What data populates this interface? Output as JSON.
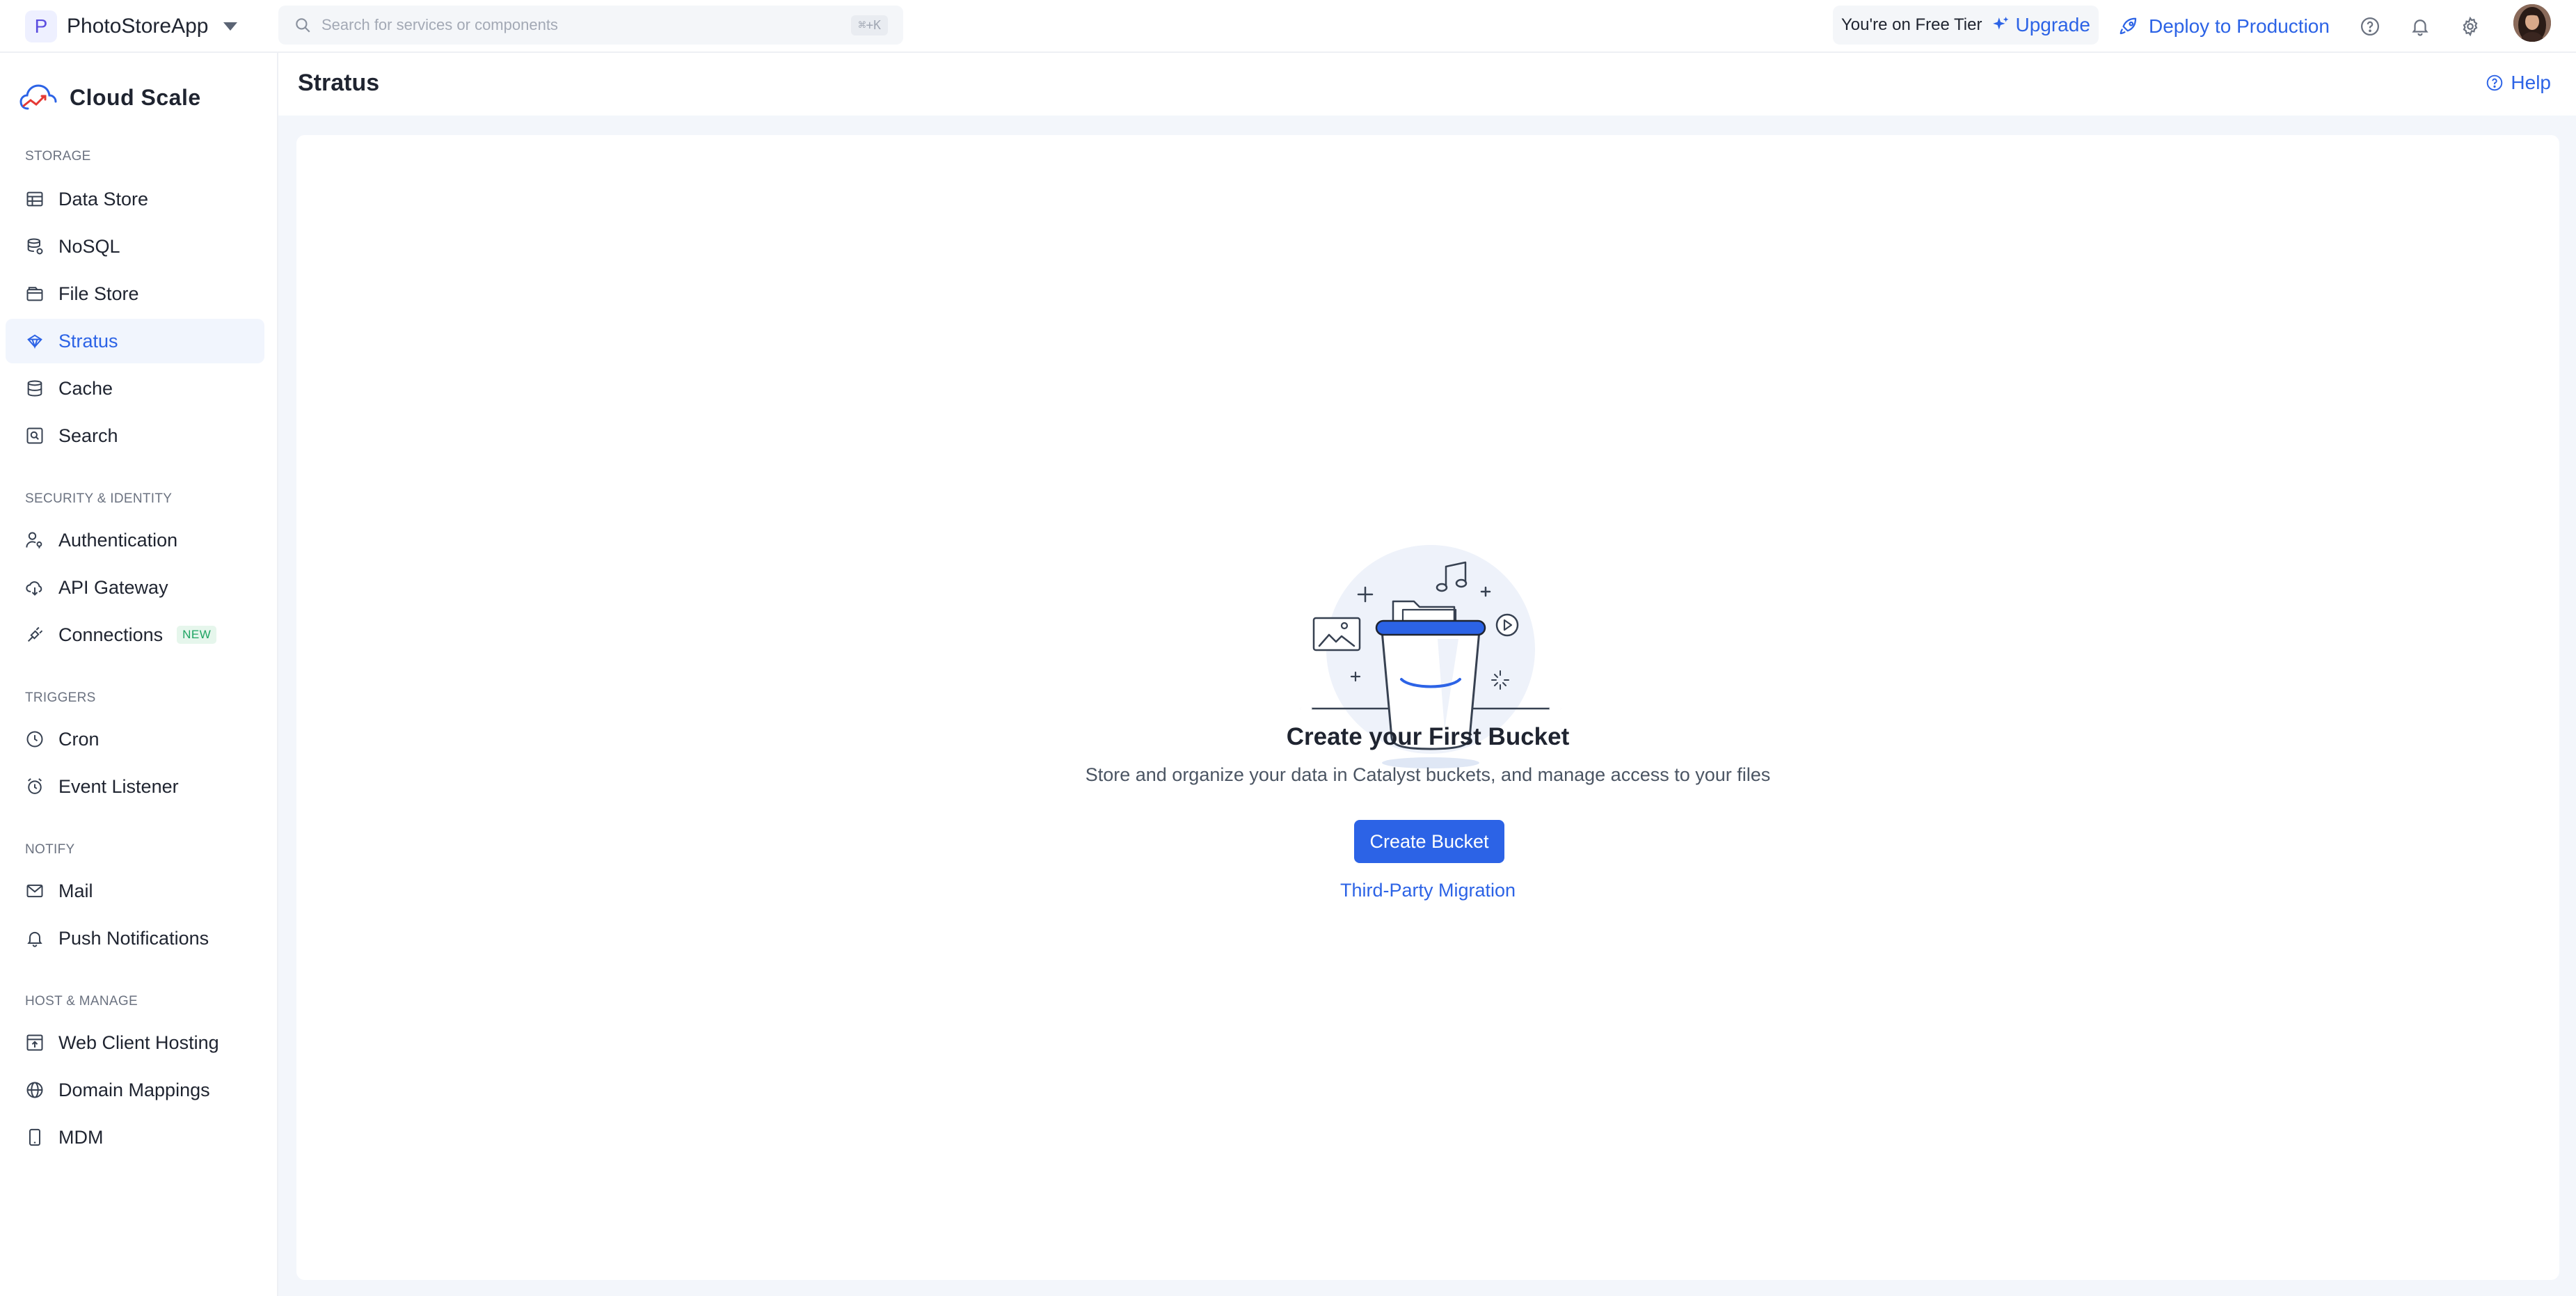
{
  "colors": {
    "accent": "#2c63e6",
    "active_bg": "#f1f5fd",
    "text": "#1f2430",
    "muted": "#6b7280",
    "new_badge": "#1fa463",
    "main_bg": "#f3f6fb"
  },
  "topbar": {
    "app_letter": "P",
    "app_name": "PhotoStoreApp",
    "search_placeholder": "Search for services or components",
    "search_shortcut": "⌘+K",
    "tier_text": "You're on Free Tier",
    "upgrade_label": "Upgrade",
    "deploy_label": "Deploy to Production",
    "icons": [
      "help-circle-icon",
      "bell-icon",
      "gear-icon"
    ]
  },
  "sidebar": {
    "brand": "Cloud Scale",
    "sections": [
      {
        "label": "STORAGE",
        "items": [
          {
            "label": "Data Store",
            "icon": "table-icon"
          },
          {
            "label": "NoSQL",
            "icon": "database-stack-icon"
          },
          {
            "label": "File Store",
            "icon": "folder-icon"
          },
          {
            "label": "Stratus",
            "icon": "stratus-icon",
            "active": true
          },
          {
            "label": "Cache",
            "icon": "cylinder-icon"
          },
          {
            "label": "Search",
            "icon": "search-box-icon"
          }
        ]
      },
      {
        "label": "SECURITY & IDENTITY",
        "items": [
          {
            "label": "Authentication",
            "icon": "user-key-icon"
          },
          {
            "label": "API Gateway",
            "icon": "cloud-gateway-icon"
          },
          {
            "label": "Connections",
            "icon": "plug-icon",
            "badge": "NEW"
          }
        ]
      },
      {
        "label": "TRIGGERS",
        "items": [
          {
            "label": "Cron",
            "icon": "clock-icon"
          },
          {
            "label": "Event Listener",
            "icon": "alarm-icon"
          }
        ]
      },
      {
        "label": "NOTIFY",
        "items": [
          {
            "label": "Mail",
            "icon": "mail-icon"
          },
          {
            "label": "Push Notifications",
            "icon": "bell-icon"
          }
        ]
      },
      {
        "label": "HOST & MANAGE",
        "items": [
          {
            "label": "Web Client Hosting",
            "icon": "web-hosting-icon"
          },
          {
            "label": "Domain Mappings",
            "icon": "globe-icon"
          },
          {
            "label": "MDM",
            "icon": "phone-icon"
          }
        ]
      }
    ]
  },
  "main": {
    "title": "Stratus",
    "help_label": "Help",
    "empty_state": {
      "title": "Create your First Bucket",
      "description": "Store and organize your data in Catalyst buckets, and manage access to your files",
      "primary_button": "Create Bucket",
      "secondary_link": "Third-Party Migration"
    }
  }
}
